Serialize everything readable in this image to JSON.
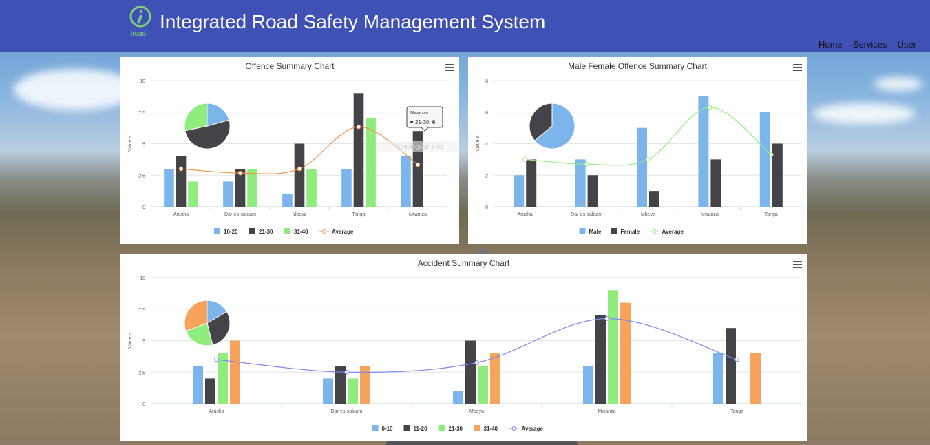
{
  "header": {
    "title": "Integrated Road Safety Management System",
    "logo_text": "iroad",
    "nav": [
      "Home",
      "Services",
      "User"
    ]
  },
  "colors": {
    "blue": "#7cb5ec",
    "dark": "#434348",
    "green": "#90ed7d",
    "orange": "#f7a35c",
    "avg_orange": "#f28f43",
    "avg_green": "#90ed7d",
    "avg_purple": "#8085e9"
  },
  "ghost_text": "Rectangular Snip",
  "chart_data": [
    {
      "type": "bar",
      "title": "Offence Summary Chart",
      "ylabel": "Value s",
      "ylim": [
        0,
        10
      ],
      "yticks": [
        "0",
        "2.5",
        "5",
        "7.5",
        "10"
      ],
      "categories": [
        "Arusha",
        "Dar-es-salaam",
        "Mbeya",
        "Tanga",
        "Mwanza"
      ],
      "series": [
        {
          "name": "10-20",
          "values": [
            3,
            2,
            1,
            3,
            4
          ],
          "color": "#7cb5ec"
        },
        {
          "name": "21-30",
          "values": [
            4,
            3,
            5,
            9,
            6
          ],
          "color": "#434348"
        },
        {
          "name": "31-40",
          "values": [
            2,
            3,
            3,
            7,
            null
          ],
          "color": "#90ed7d"
        }
      ],
      "average": {
        "name": "Average",
        "values": [
          3,
          2.67,
          3,
          6.33,
          3.33
        ],
        "color": "#f28f43"
      },
      "pie": [
        {
          "value": 11,
          "color": "#7cb5ec"
        },
        {
          "value": 27,
          "color": "#434348"
        },
        {
          "value": 15,
          "color": "#90ed7d"
        }
      ],
      "tooltip": {
        "title": "Mwanza",
        "label": "21-30: ",
        "value": "6"
      }
    },
    {
      "type": "bar",
      "title": "Male Female Offence Summary Chart",
      "ylabel": "Value s",
      "ylim": [
        0,
        8
      ],
      "yticks": [
        "0",
        "2",
        "4",
        "6",
        "8"
      ],
      "categories": [
        "Arusha",
        "Dar-es-salaam",
        "Mbeya",
        "Mwanza",
        "Tanga"
      ],
      "series": [
        {
          "name": "Male",
          "values": [
            2,
            3,
            5,
            7,
            6
          ],
          "color": "#7cb5ec"
        },
        {
          "name": "Female",
          "values": [
            3,
            2,
            1,
            3,
            4
          ],
          "color": "#434348"
        }
      ],
      "average": {
        "name": "Average",
        "values": [
          3,
          2.7,
          3,
          6.3,
          3.3
        ],
        "color": "#90ed7d"
      },
      "pie": [
        {
          "value": 23,
          "color": "#7cb5ec"
        },
        {
          "value": 13,
          "color": "#434348"
        }
      ]
    },
    {
      "type": "bar",
      "title": "Accident Summary Chart",
      "ylabel": "Value s",
      "ylim": [
        0,
        10
      ],
      "yticks": [
        "0",
        "2.5",
        "5",
        "7.5",
        "10"
      ],
      "categories": [
        "Arusha",
        "Dar-es-salaam",
        "Mbeya",
        "Mwanza",
        "Tanga"
      ],
      "series": [
        {
          "name": "0-10",
          "values": [
            3,
            2,
            1,
            3,
            4
          ],
          "color": "#7cb5ec"
        },
        {
          "name": "11-20",
          "values": [
            2,
            3,
            5,
            7,
            6
          ],
          "color": "#434348"
        },
        {
          "name": "21-30",
          "values": [
            4,
            2,
            3,
            9,
            null
          ],
          "color": "#90ed7d"
        },
        {
          "name": "31-40",
          "values": [
            5,
            3,
            4,
            8,
            4
          ],
          "color": "#f7a35c"
        }
      ],
      "average": {
        "name": "Average",
        "values": [
          3.5,
          2.5,
          3.25,
          6.75,
          3.5
        ],
        "color": "#8085e9"
      },
      "pie": [
        {
          "value": 13,
          "color": "#7cb5ec"
        },
        {
          "value": 23,
          "color": "#434348"
        },
        {
          "value": 18,
          "color": "#90ed7d"
        },
        {
          "value": 24,
          "color": "#f7a35c"
        }
      ]
    }
  ]
}
